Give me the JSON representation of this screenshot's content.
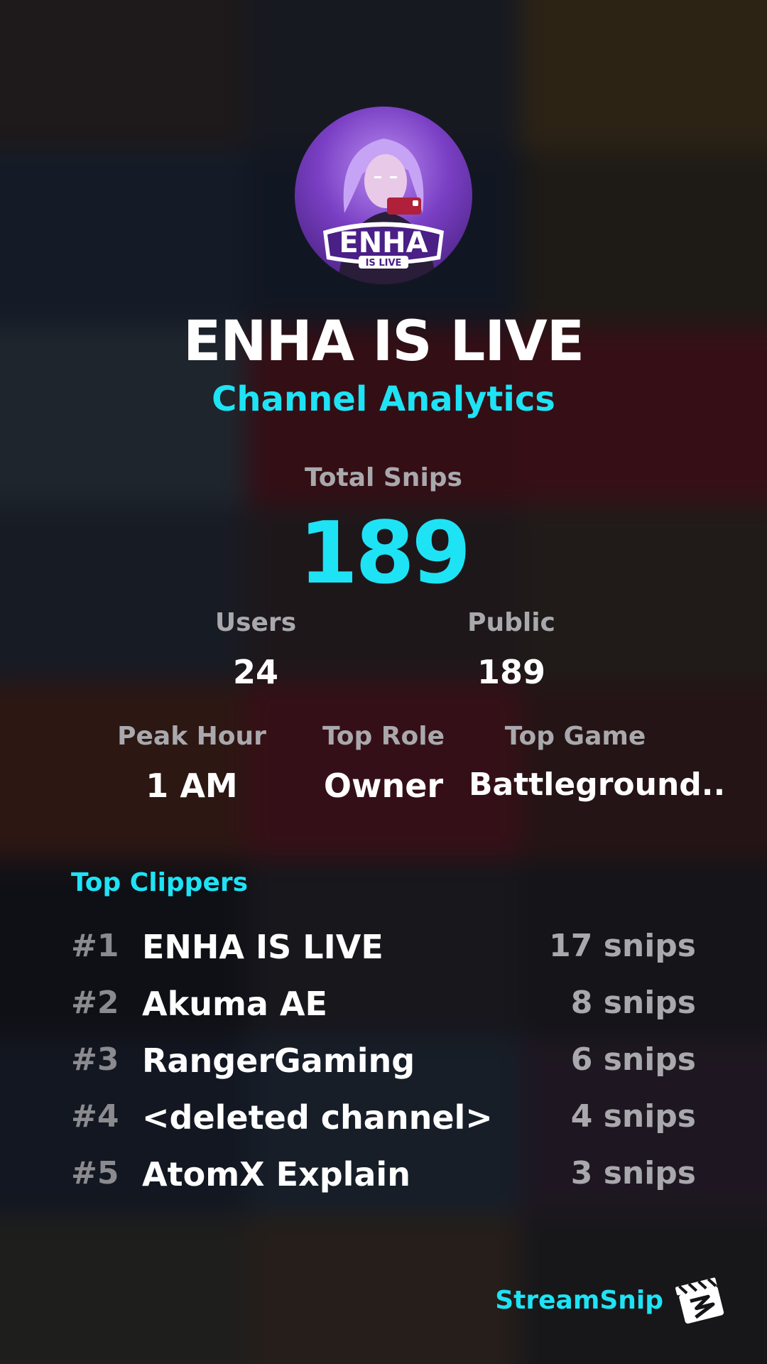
{
  "channel": {
    "title": "ENHA IS LIVE",
    "subtitle": "Channel Analytics",
    "avatar_text": "ENHA",
    "avatar_subtext": "IS LIVE"
  },
  "totals": {
    "label": "Total Snips",
    "value": "189"
  },
  "stats": {
    "users": {
      "label": "Users",
      "value": "24"
    },
    "public": {
      "label": "Public",
      "value": "189"
    },
    "peak_hour": {
      "label": "Peak Hour",
      "value": "1 AM"
    },
    "top_role": {
      "label": "Top Role",
      "value": "Owner"
    },
    "top_game": {
      "label": "Top Game",
      "value": "Battleground.."
    }
  },
  "clippers": {
    "heading": "Top Clippers",
    "rows": [
      {
        "rank": "#1",
        "name": "ENHA IS LIVE",
        "count": "17 snips"
      },
      {
        "rank": "#2",
        "name": "Akuma AE",
        "count": "8 snips"
      },
      {
        "rank": "#3",
        "name": "RangerGaming",
        "count": "6 snips"
      },
      {
        "rank": "#4",
        "name": "<deleted channel>",
        "count": "4 snips"
      },
      {
        "rank": "#5",
        "name": "AtomX Explain",
        "count": "3 snips"
      }
    ]
  },
  "brand": {
    "name": "StreamSnip",
    "logo_icon": "clapperboard-icon"
  },
  "colors": {
    "accent": "#1ee3f5",
    "text_primary": "#ffffff",
    "text_muted": "#a9a9ad",
    "rank_muted": "#8a8a8f",
    "background": "#141417"
  }
}
